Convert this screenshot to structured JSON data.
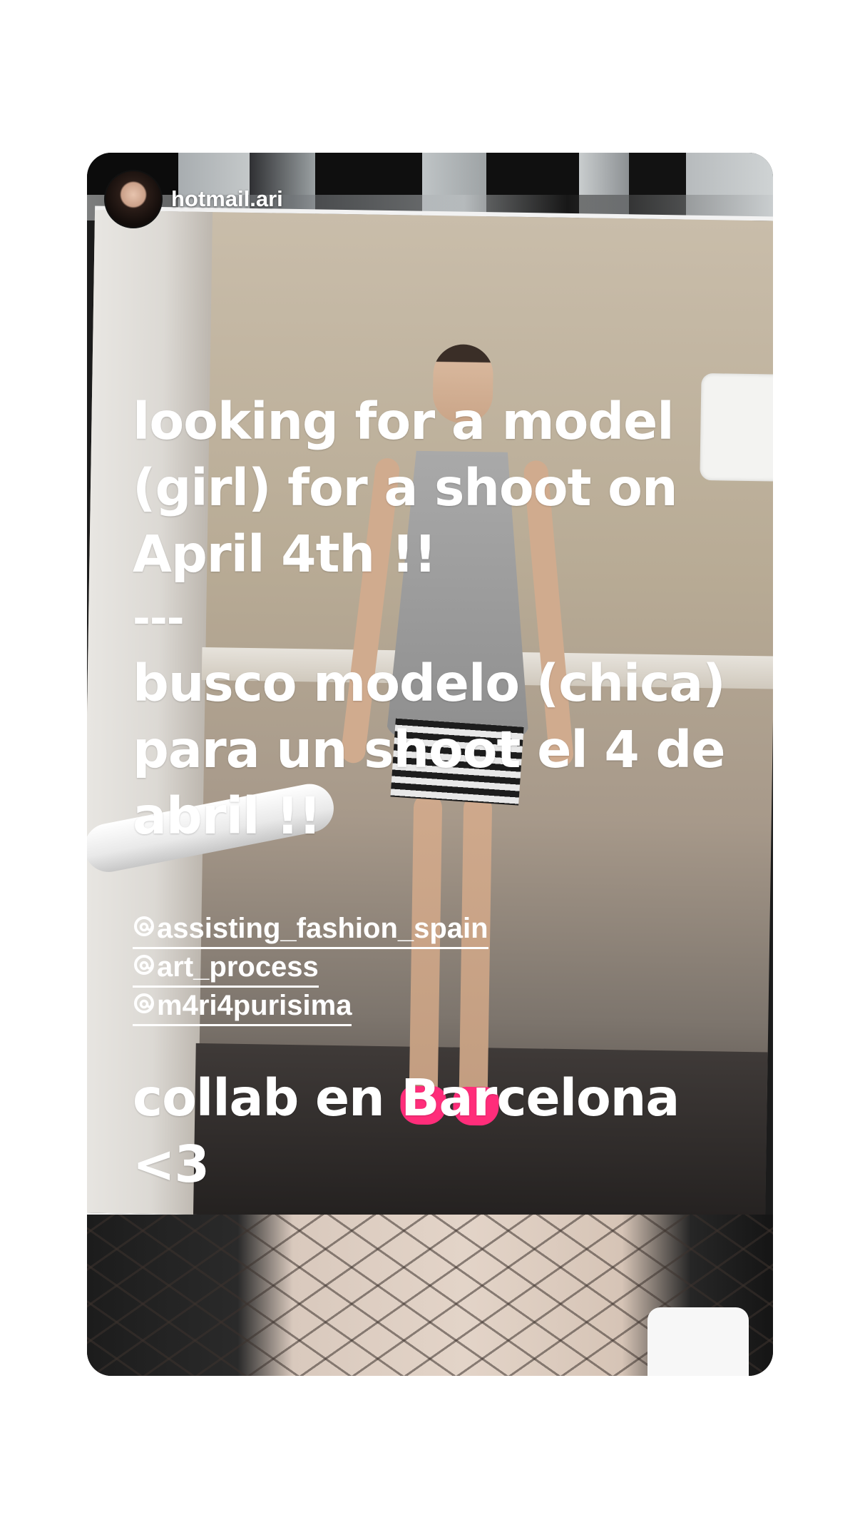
{
  "story": {
    "username": "hotmail.ari",
    "text_lines": [
      "looking for a model",
      "(girl) for a shoot on",
      "April 4th !!",
      "---",
      "busco modelo (chica)",
      "para un shoot el 4 de",
      "abril !!"
    ],
    "mentions": [
      "assisting_fashion_spain",
      "art_process",
      "m4ri4purisima"
    ],
    "closing_lines": [
      "collab en Barcelona",
      "<3"
    ]
  },
  "icons": {
    "mention_icon": "threads-icon",
    "avatar": "avatar"
  },
  "colors": {
    "overlay_text": "#ffffff",
    "shoes": "#ff2d7a",
    "page_background": "#ffffff"
  }
}
